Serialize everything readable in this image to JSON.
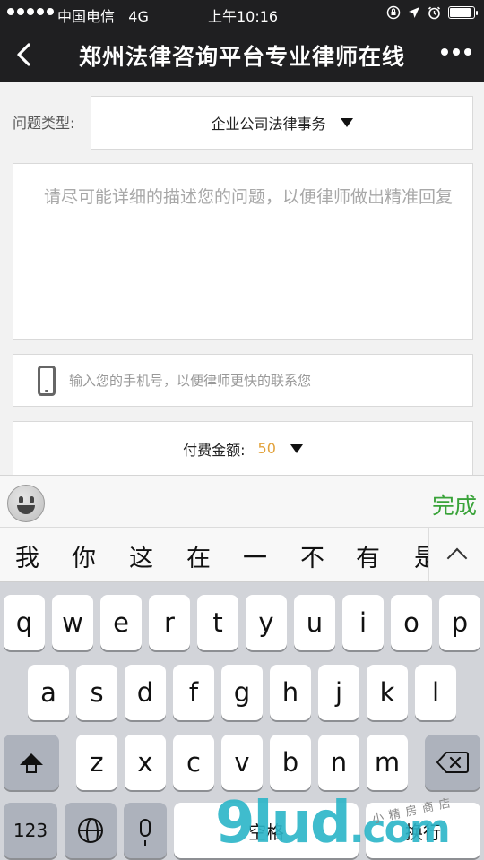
{
  "status_bar": {
    "carrier": "中国电信",
    "network": "4G",
    "time": "上午10:16"
  },
  "nav": {
    "title": "郑州法律咨询平台专业律师在线"
  },
  "form": {
    "type_label": "问题类型:",
    "type_value": "企业公司法律事务",
    "description_placeholder": "请尽可能详细的描述您的问题，以便律师做出精准回复",
    "phone_placeholder": "输入您的手机号，以便律师更快的联系您",
    "fee_label": "付费金额:",
    "fee_amount": "50"
  },
  "toolbar": {
    "done_label": "完成"
  },
  "candidates": [
    "我",
    "你",
    "这",
    "在",
    "一",
    "不",
    "有",
    "是"
  ],
  "keyboard": {
    "row1": [
      "q",
      "w",
      "e",
      "r",
      "t",
      "y",
      "u",
      "i",
      "o",
      "p"
    ],
    "row2": [
      "a",
      "s",
      "d",
      "f",
      "g",
      "h",
      "j",
      "k",
      "l"
    ],
    "row3": [
      "z",
      "x",
      "c",
      "v",
      "b",
      "n",
      "m"
    ],
    "num_label": "123",
    "space_label": "空格",
    "return_label": "换行"
  },
  "watermark": {
    "brand": "9lud",
    "tld": ".com",
    "tagline": "小精房商店"
  },
  "colors": {
    "nav_bg": "#1f1f21",
    "done_green": "#3aa33a",
    "fee_orange": "#e2a23b"
  }
}
